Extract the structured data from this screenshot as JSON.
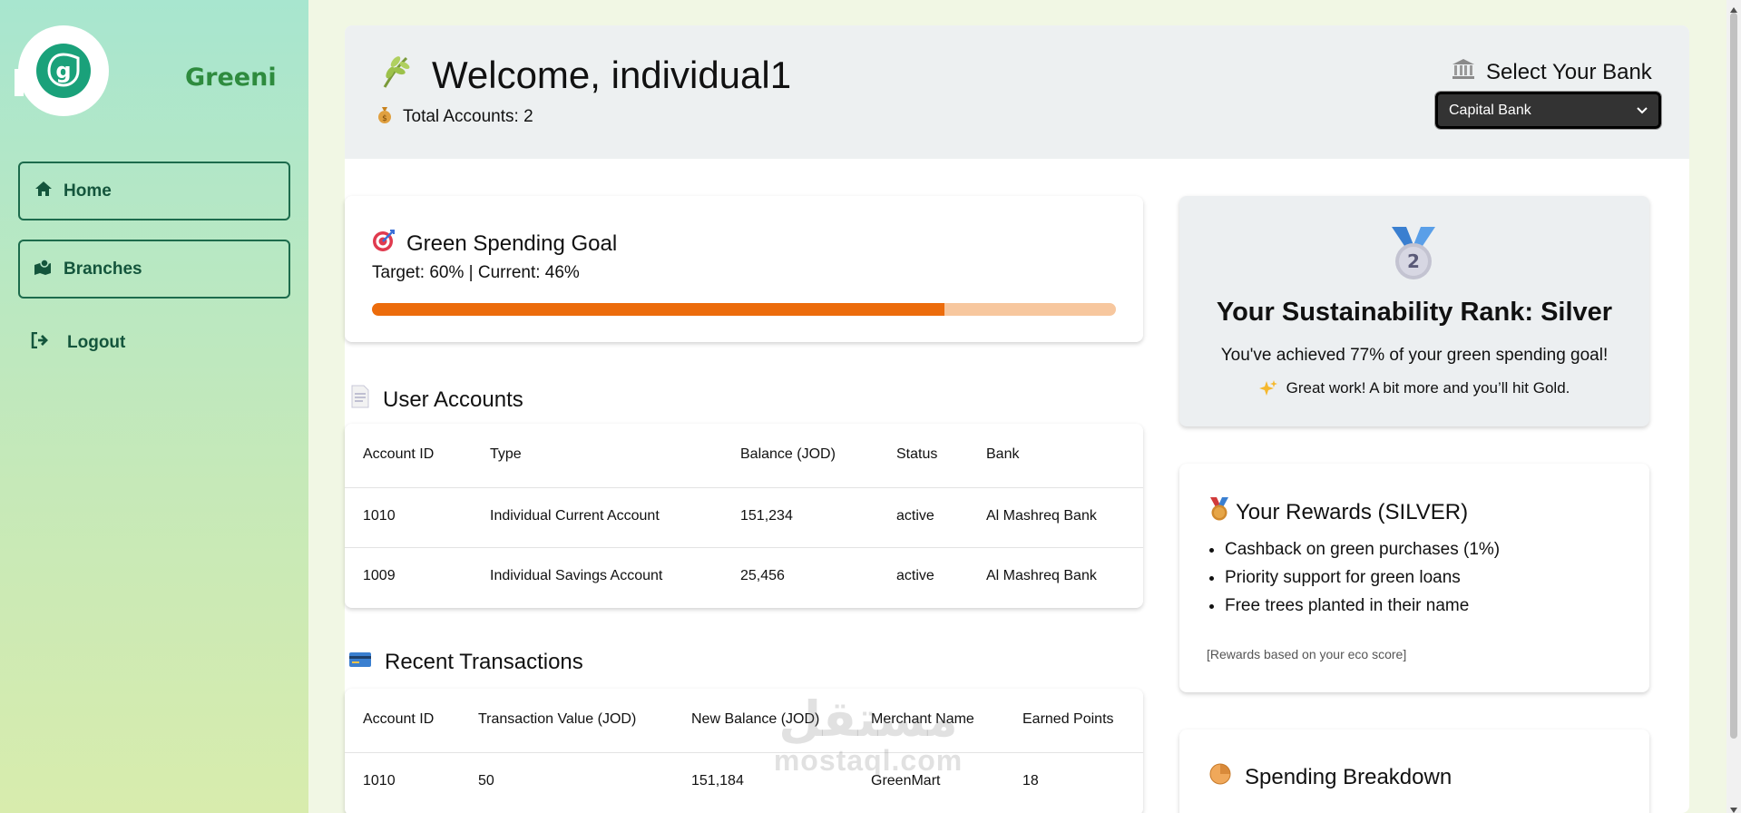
{
  "sidebar": {
    "brand": "Greeni",
    "logo_letter": "g",
    "items": [
      {
        "label": "Home",
        "icon": "home-icon"
      },
      {
        "label": "Branches",
        "icon": "map-marker-icon"
      },
      {
        "label": "Logout",
        "icon": "logout-icon"
      }
    ]
  },
  "header": {
    "welcome": "Welcome, individual1",
    "total_accounts": "Total Accounts: 2",
    "bank_label": "Select Your Bank",
    "bank_selected": "Capital Bank"
  },
  "goal": {
    "title": "Green Spending Goal",
    "subtitle": "Target: 60% | Current: 46%",
    "progress_percent": 77
  },
  "accounts": {
    "title": "User Accounts",
    "columns": [
      "Account ID",
      "Type",
      "Balance (JOD)",
      "Status",
      "Bank"
    ],
    "rows": [
      [
        "1010",
        "Individual Current Account",
        "151,234",
        "active",
        "Al Mashreq Bank"
      ],
      [
        "1009",
        "Individual Savings Account",
        "25,456",
        "active",
        "Al Mashreq Bank"
      ]
    ]
  },
  "transactions": {
    "title": "Recent Transactions",
    "columns": [
      "Account ID",
      "Transaction Value (JOD)",
      "New Balance (JOD)",
      "Merchant Name",
      "Earned Points"
    ],
    "rows": [
      [
        "1010",
        "50",
        "151,184",
        "GreenMart",
        "18"
      ]
    ]
  },
  "rank": {
    "medal_number": "2",
    "title": "Your Sustainability Rank: Silver",
    "subtitle": "You've achieved 77% of your green spending goal!",
    "note": "Great work! A bit more and you’ll hit Gold."
  },
  "rewards": {
    "title": "Your Rewards (SILVER)",
    "items": [
      "Cashback on green purchases (1%)",
      "Priority support for green loans",
      "Free trees planted in their name"
    ],
    "footnote": "[Rewards based on your eco score]"
  },
  "spending": {
    "title": "Spending Breakdown"
  },
  "watermark": {
    "arabic": "مستقل",
    "latin": "mostaql.com"
  },
  "colors": {
    "brand_green": "#2e8b3e",
    "logo_teal": "#1aa17a",
    "progress_fill": "#ec6c0c",
    "progress_track": "#f7c79e"
  }
}
